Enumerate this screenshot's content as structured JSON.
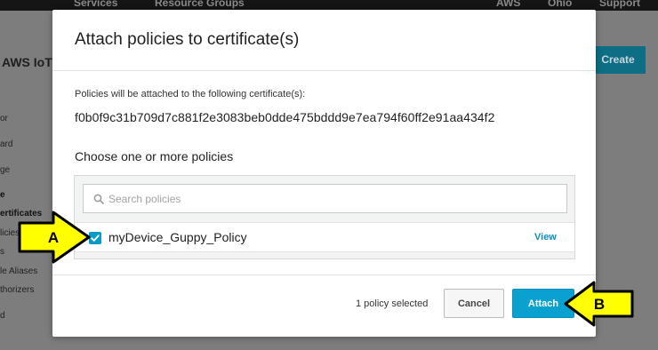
{
  "topbar": {
    "services_label": "Services",
    "resource_groups_label": "Resource Groups",
    "region_aws_label": "AWS",
    "region_label": "Ohio",
    "support_label": "Support"
  },
  "background": {
    "title": "AWS IoT",
    "create_button": "Create",
    "sidebar_fragments": [
      "or",
      "ard",
      "ge",
      "e",
      "ertificates",
      "licies",
      "s",
      "le Aliases",
      "thorizers",
      "d"
    ]
  },
  "modal": {
    "title": "Attach policies to certificate(s)",
    "info_label": "Policies will be attached to the following certificate(s):",
    "certificate_id": "f0b0f9c31b709d7c881f2e3083beb0dde475bddd9e7ea794f60ff2e91aa434f2",
    "choose_label": "Choose one or more policies",
    "search": {
      "placeholder": "Search policies"
    },
    "policies": [
      {
        "name": "myDevice_Guppy_Policy",
        "checked": true,
        "view_label": "View"
      }
    ],
    "footer": {
      "selected_count": "1 policy selected",
      "cancel_label": "Cancel",
      "attach_label": "Attach"
    }
  },
  "annotations": {
    "arrow_a_label": "A",
    "arrow_b_label": "B",
    "arrow_color": "#ffff00"
  }
}
